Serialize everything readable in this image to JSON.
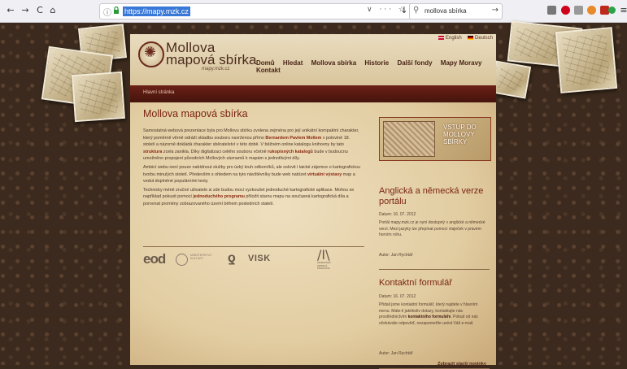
{
  "browser": {
    "url": "https://mapy.mzk.cz",
    "search_value": "mollova sbírka",
    "back_icon": "←",
    "forward_icon": "→",
    "reload_icon": "C",
    "home_icon": "⌂",
    "url_tools": "∨ ··· ☆",
    "download_icon": "↓",
    "search_icon": "⚲",
    "go_icon": "→"
  },
  "header": {
    "logo_line1": "Mollova",
    "logo_line2": "mapová sbírka",
    "logo_domain": "mapy.mzk.cz",
    "lang_en": "English",
    "lang_de": "Deutsch",
    "menu": [
      "Domů",
      "Hledat",
      "Mollova sbírka",
      "Historie",
      "Další fondy",
      "Mapy Moravy",
      "Kontakt"
    ],
    "breadcrumb": "Hlavní stránka"
  },
  "main": {
    "title": "Mollova mapová sbírka",
    "para1": [
      "Samostatná webová prezentace byla pro Mollovu sbírku zvolena zejména pro její unikátní kompaktní charakter, který poměrně věrně odráží skladbu souboru navrženou přímo ",
      "Bernardem Pavlem Mollem",
      " v polovině 18. století a názorně dokládá charakter sběratelství v této době. V běžném online katalogu knihovny by tato ",
      "struktura",
      " zcela zanikla. Díky digitalizaci celého souboru včetně ",
      "rukopisných katalogů",
      " bude v budoucnu umožněno propojení původních Mollových záznamů k mapám s jednotlivými díly."
    ],
    "para2": [
      "Ambicí webu není pouze nabídnout služby pro úzký kruh odborníků, ale oslovit i laické zájemce o kartografickou tvorbu minulých století. Především s ohledem na tyto návštěvníky bude web nabízet ",
      "virtuální výstavy",
      " map a vedut doplněné populárními texty."
    ],
    "para3": [
      "Technicky méně zručné uživatele si zde budou moci vyzkoušet jednoduché kartografické aplikace. Mohou se například pokusit pomocí ",
      "jednoduchého programu",
      " přiložit starou mapu na současná kartografická díla a porovnat proměny zobrazovaného území během posledních staletí."
    ],
    "partners": {
      "eod": "eod",
      "ministry": "MINISTERSTVO KULTURY",
      "visk": "VISK",
      "mzk_mark": "/I\\",
      "mzk": "MORAVSKÁ ZEMSKÁ KNIHOVNA"
    }
  },
  "sidebar": {
    "enter_label": "VSTUP DO MOLLOVY SBÍRKY",
    "news": [
      {
        "title": "Anglická a německá verze portálu",
        "date": "Datum: 16. 07. 2012",
        "text": "Portál mapy.mzk.cz je nyní dostupný v anglické a německé verzi. Mezi jazyky lze přepínat pomocí vlaječek v pravém horním rohu.",
        "author": "Autor: Jan Rychtář"
      },
      {
        "title": "Kontaktní formulář",
        "date": "Datum: 16. 07. 2012",
        "text_pre": "Přidali jsme kontaktní formulář, který najdete v hlavním menu. Máte-li jakékoliv dotazy, kontaktujte nás prostřednictvím ",
        "text_bold": "kontaktního formuláře",
        "text_post": ". Pokud od nás očekáváte odpověď, nezapomeňte uvést Váš e-mail.",
        "author": "Autor: Jan Rychtář"
      }
    ],
    "older_news": "Zobrazit starší novinky"
  }
}
